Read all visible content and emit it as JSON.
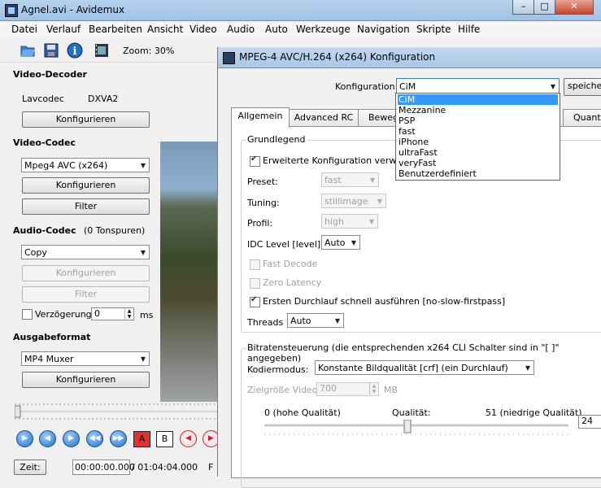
{
  "window": {
    "title": "Agnel.avi - Avidemux",
    "min": "–",
    "max": "□",
    "close": "✕"
  },
  "menu": [
    "Datei",
    "Verlauf",
    "Bearbeiten",
    "Ansicht",
    "Video",
    "Audio",
    "Auto",
    "Werkzeuge",
    "Navigation",
    "Skripte",
    "Hilfe"
  ],
  "toolbar": {
    "zoom_label": "Zoom: 30%"
  },
  "left": {
    "video_decoder": {
      "heading": "Video-Decoder",
      "codec_name": "Lavcodec",
      "codec_value": "DXVA2",
      "configure": "Konfigurieren"
    },
    "video_codec": {
      "heading": "Video-Codec",
      "selected": "Mpeg4 AVC (x264)",
      "configure": "Konfigurieren",
      "filter": "Filter"
    },
    "audio_codec": {
      "heading": "Audio-Codec",
      "tracks": "(0 Tonspuren)",
      "selected": "Copy",
      "configure": "Konfigurieren",
      "filter": "Filter",
      "delay_label": "Verzögerung:",
      "delay_value": "0",
      "delay_unit": "ms"
    },
    "output_format": {
      "heading": "Ausgabeformat",
      "selected": "MP4 Muxer",
      "configure": "Konfigurieren"
    },
    "time": {
      "button": "Zeit:",
      "current": "00:00:00.000",
      "total": "/ 01:04:04.000",
      "trailing": "F"
    },
    "ab_markers": {
      "a": "A",
      "b": "B"
    }
  },
  "dialog": {
    "title": "MPEG-4 AVC/H.264 (x264) Konfiguration",
    "config_label": "Konfiguration:",
    "config_selected": "CiM",
    "save_button": "speichern",
    "dropdown_options": [
      "CiM",
      "Mezzanine",
      "PSP",
      "fast",
      "iPhone",
      "ultraFast",
      "veryFast",
      "Benutzerdefiniert"
    ],
    "tabs": [
      "Allgemein",
      "Advanced RC",
      "Bewegu",
      "Quantis"
    ],
    "basic": {
      "heading": "Grundlegend",
      "extended_config": "Erweiterte Konfiguration verwende",
      "preset_label": "Preset:",
      "preset_value": "fast",
      "tuning_label": "Tuning:",
      "tuning_value": "stillimage",
      "profile_label": "Profil:",
      "profile_value": "high",
      "idc_label": "IDC Level [level]:",
      "idc_value": "Auto",
      "fast_decode": "Fast Decode",
      "zero_latency": "Zero Latency",
      "first_pass": "Ersten Durchlauf schnell ausführen [no-slow-firstpass]",
      "threads_label": "Threads",
      "threads_value": "Auto"
    },
    "bitrate": {
      "heading": "Bitratensteuerung (die entsprechenden x264 CLI Schalter sind in \"[ ]\" angegeben)",
      "mode_label": "Kodiermodus:",
      "mode_value": "Konstante Bildqualität [crf] (ein Durchlauf)",
      "target_label": "Zielgröße Video:",
      "target_value": "700",
      "target_unit": "MB",
      "quality_low": "0 (hohe Qualität)",
      "quality_label": "Qualität:",
      "quality_high": "51 (niedrige Qualität)",
      "quality_value": "24",
      "quality_slider": 0.47
    }
  }
}
